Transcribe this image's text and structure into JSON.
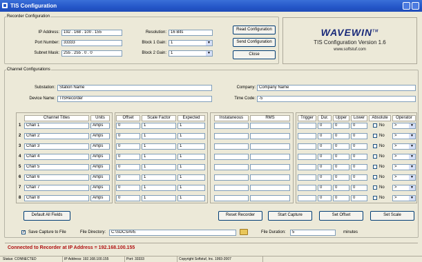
{
  "window": {
    "title": "TIS Configuration"
  },
  "recorder": {
    "legend": "Recorder Configuration",
    "ip_label": "IP Address:",
    "ip_value": "192 . 168 . 100 . 155",
    "port_label": "Port Number:",
    "port_value": "33333",
    "subnet_label": "Subnet Mask:",
    "subnet_value": "255 . 255 . 0 . 0",
    "resolution_label": "Resolution:",
    "resolution_value": "16 Bits",
    "block1_label": "Block 1 Gain:",
    "block1_value": "1",
    "block2_label": "Block 2 Gain:",
    "block2_value": "1",
    "read_label": "Read Configuration",
    "send_label": "Send Configuration",
    "close_label": "Close"
  },
  "brand": {
    "logo": "WAVEWIN",
    "tm": "TM",
    "version": "TIS Configuration Version 1.6",
    "url": "www.softstuf.com"
  },
  "channel": {
    "legend": "Channel Configurations",
    "substation_label": "Substation:",
    "substation_value": "Station Name",
    "device_label": "Device Name:",
    "device_value": "TISRecorder",
    "company_label": "Company:",
    "company_value": "Company Name",
    "timecode_label": "Time Code:",
    "timecode_value": "-5"
  },
  "table": {
    "headers": {
      "titles": "Channel Titles",
      "units": "Units",
      "offset": "Offset",
      "scale": "Scale Factor",
      "expected": "Expected",
      "inst": "Instataneous",
      "rms": "RMS",
      "trigger": "Trigger",
      "dur": "Dur.",
      "upper": "Upper",
      "lower": "Lower",
      "absolute": "Absolute",
      "operator": "Operator"
    },
    "rows": [
      {
        "n": "1",
        "title": "Chan 1",
        "units": "Amps",
        "offset": "0",
        "scale": "1",
        "expected": "1",
        "dur": "0",
        "upper": "0",
        "lower": "0",
        "abs": "No",
        "op": ">"
      },
      {
        "n": "2",
        "title": "Chan 2",
        "units": "Amps",
        "offset": "0",
        "scale": "1",
        "expected": "1",
        "dur": "0",
        "upper": "0",
        "lower": "0",
        "abs": "No",
        "op": ">"
      },
      {
        "n": "3",
        "title": "Chan 3",
        "units": "Amps",
        "offset": "0",
        "scale": "1",
        "expected": "1",
        "dur": "0",
        "upper": "0",
        "lower": "0",
        "abs": "No",
        "op": ">"
      },
      {
        "n": "4",
        "title": "Chan 4",
        "units": "Amps",
        "offset": "0",
        "scale": "1",
        "expected": "1",
        "dur": "0",
        "upper": "0",
        "lower": "0",
        "abs": "No",
        "op": ">"
      },
      {
        "n": "5",
        "title": "Chan 5",
        "units": "Amps",
        "offset": "0",
        "scale": "1",
        "expected": "1",
        "dur": "0",
        "upper": "0",
        "lower": "0",
        "abs": "No",
        "op": ">"
      },
      {
        "n": "6",
        "title": "Chan 6",
        "units": "Amps",
        "offset": "0",
        "scale": "1",
        "expected": "1",
        "dur": "0",
        "upper": "0",
        "lower": "0",
        "abs": "No",
        "op": ">"
      },
      {
        "n": "7",
        "title": "Chan 7",
        "units": "Amps",
        "offset": "0",
        "scale": "1",
        "expected": "1",
        "dur": "0",
        "upper": "0",
        "lower": "0",
        "abs": "No",
        "op": ">"
      },
      {
        "n": "8",
        "title": "Chan 8",
        "units": "Amps",
        "offset": "0",
        "scale": "1",
        "expected": "1",
        "dur": "0",
        "upper": "0",
        "lower": "0",
        "abs": "No",
        "op": ">"
      }
    ]
  },
  "actions": {
    "default": "Default All Fields",
    "reset": "Reset Recorder",
    "start": "Start Capture",
    "offset": "Set Offset",
    "scale": "Set Scale"
  },
  "save": {
    "checkbox_label": "Save Capture to File",
    "dir_label": "File Directory:",
    "dir_value": "C:\\SDCSAVE",
    "duration_label": "File Duration:",
    "duration_value": "5",
    "minutes": "minutes"
  },
  "banner": "Connected to Recorder at IP Address = 192.168.100.155",
  "status": {
    "state": "Status: CONNECTED",
    "ip": "IP Address: 192.168.100.155",
    "port": "Port: 33333",
    "copy": "Copyright Softstuf, Inc. 1993-2007"
  },
  "colors": {
    "titlebar": "#2456c8",
    "banner_text": "#b01010"
  }
}
